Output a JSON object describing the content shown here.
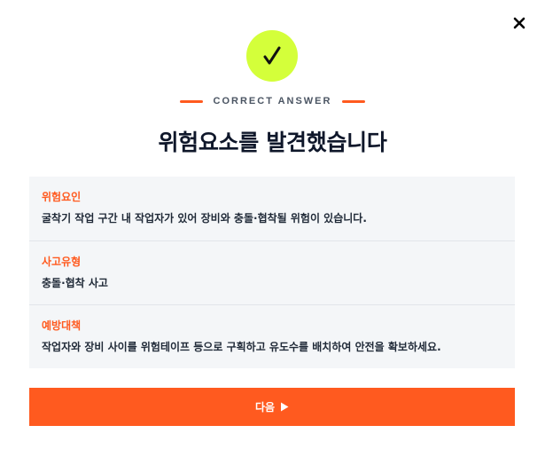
{
  "modal": {
    "eyebrow": "CORRECT ANSWER",
    "title": "위험요소를 발견했습니다",
    "icons": {
      "close": "close-icon",
      "check": "check-icon",
      "next": "play-arrow-icon"
    },
    "colors": {
      "accent": "#ff5a1f",
      "check_bg": "#d4ff3a",
      "panel_bg": "#f4f6f8"
    }
  },
  "details": [
    {
      "label": "위험요인",
      "value": "굴착기 작업 구간 내 작업자가 있어 장비와 충돌·협착될 위험이 있습니다."
    },
    {
      "label": "사고유형",
      "value": "충돌·협착 사고"
    },
    {
      "label": "예방대책",
      "value": "작업자와 장비 사이를 위험테이프 등으로 구획하고 유도수를 배치하여 안전을 확보하세요."
    }
  ],
  "actions": {
    "next_label": "다음"
  }
}
